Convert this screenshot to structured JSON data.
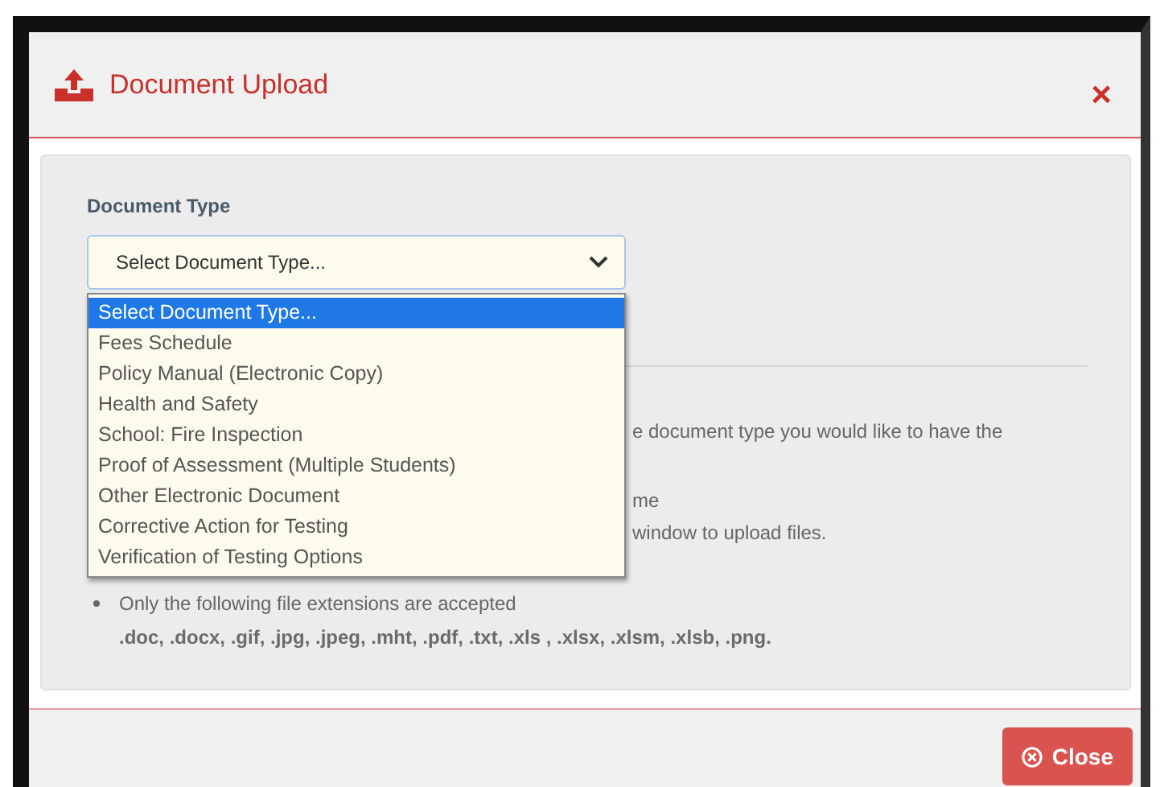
{
  "dialog": {
    "title": "Document Upload",
    "close_symbol": "×"
  },
  "form": {
    "label": "Document Type",
    "select_value": "Select Document Type...",
    "dropdown_open": true,
    "options": [
      {
        "label": "Select Document Type...",
        "selected": true
      },
      {
        "label": "Fees Schedule",
        "selected": false
      },
      {
        "label": "Policy Manual (Electronic Copy)",
        "selected": false
      },
      {
        "label": "Health and Safety",
        "selected": false
      },
      {
        "label": "School: Fire Inspection",
        "selected": false
      },
      {
        "label": "Proof of Assessment (Multiple Students)",
        "selected": false
      },
      {
        "label": "Other Electronic Document",
        "selected": false
      },
      {
        "label": "Corrective Action for Testing",
        "selected": false
      },
      {
        "label": "Verification of Testing Options",
        "selected": false
      }
    ]
  },
  "instructions_behind_dropdown": [
    {
      "text": "e document type you would like to have the"
    },
    {
      "text": "me"
    },
    {
      "text": "window to upload files."
    }
  ],
  "instructions": [
    {
      "text": "Only the following file extensions are accepted",
      "detail": ".doc, .docx, .gif, .jpg, .jpeg, .mht, .pdf, .txt, .xls , .xlsx, .xlsm, .xlsb, .png."
    }
  ],
  "footer": {
    "close_button": "Close"
  }
}
